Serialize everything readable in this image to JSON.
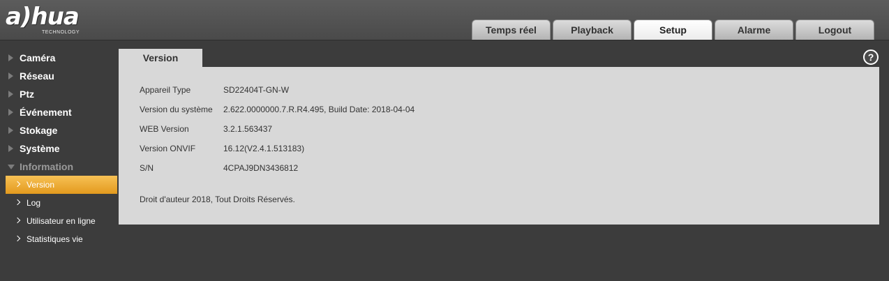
{
  "header": {
    "logo_text": "a)hua",
    "logo_sub": "TECHNOLOGY",
    "nav": [
      "Temps réel",
      "Playback",
      "Setup",
      "Alarme",
      "Logout"
    ],
    "active_nav": "Setup"
  },
  "sidebar": {
    "items": [
      "Caméra",
      "Réseau",
      "Ptz",
      "Événement",
      "Stokage",
      "Système",
      "Information"
    ],
    "expanded": "Information",
    "subitems": [
      "Version",
      "Log",
      "Utilisateur en ligne",
      "Statistiques vie"
    ],
    "selected_sub": "Version"
  },
  "content": {
    "tab_label": "Version",
    "help_label": "?",
    "rows": [
      {
        "label": "Appareil Type",
        "value": "SD22404T-GN-W"
      },
      {
        "label": "Version du système",
        "value": "2.622.0000000.7.R.R4.495, Build Date: 2018-04-04"
      },
      {
        "label": "WEB Version",
        "value": "3.2.1.563437"
      },
      {
        "label": "Version ONVIF",
        "value": "16.12(V2.4.1.513183)"
      },
      {
        "label": "S/N",
        "value": "4CPAJ9DN3436812"
      }
    ],
    "copyright": "Droit d'auteur 2018, Tout Droits Réservés."
  },
  "colors": {
    "accent": "#f0a93a",
    "background": "#3c3c3c",
    "panel": "#d8d8d8"
  }
}
